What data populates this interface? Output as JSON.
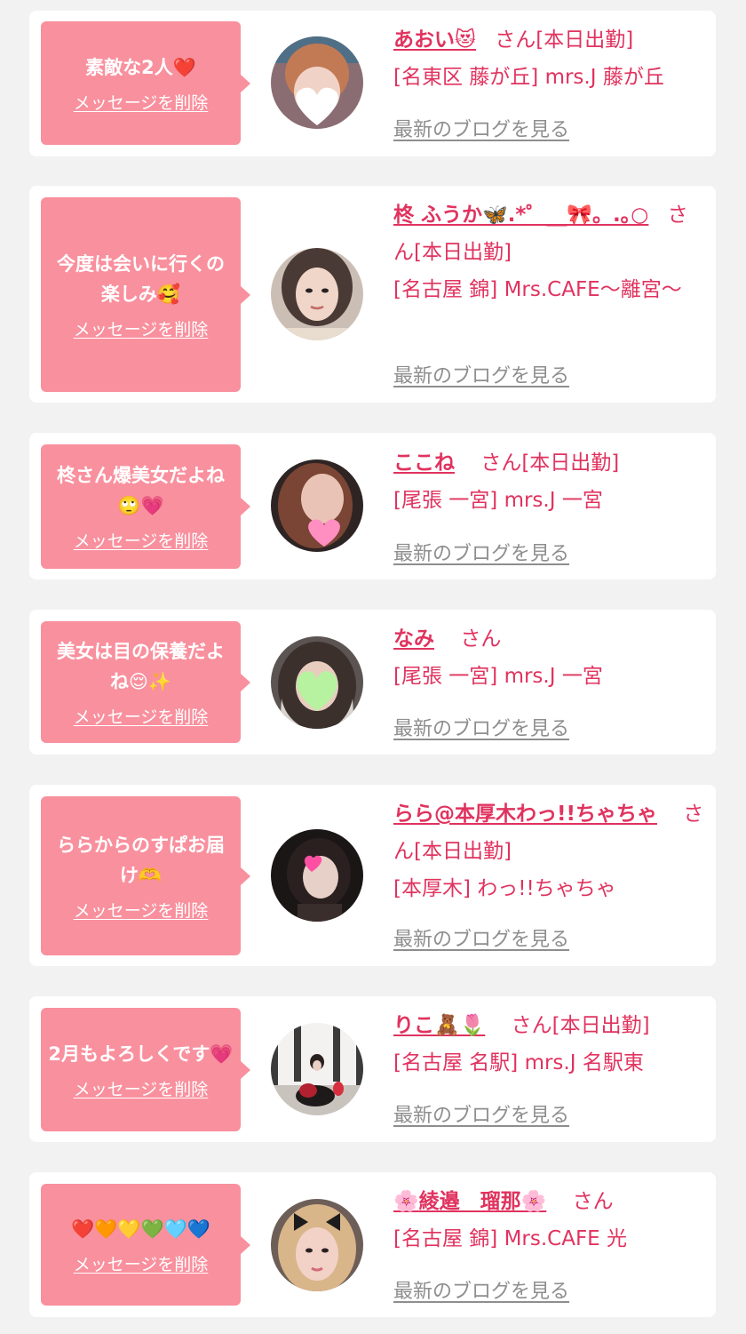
{
  "messages": [
    {
      "message": "素敵な2人❤️",
      "delete_label": "メッセージを削除",
      "avatar": "heart-blurred-avatar",
      "name": "あおい😻",
      "honorific": "さん",
      "status": "[本日出勤]",
      "shop": "[名東区 藤が丘] mrs.J 藤が丘",
      "blog_label": "最新のブログを見る"
    },
    {
      "message": "今度は会いに行くの楽しみ🥰",
      "delete_label": "メッセージを削除",
      "avatar": "woman-portrait-avatar",
      "name": "柊 ふうか🦋.*゜__🎀。.｡○",
      "honorific": "さん",
      "status": "[本日出勤]",
      "shop": "[名古屋 錦] Mrs.CAFE〜離宮〜",
      "blog_label": "最新のブログを見る"
    },
    {
      "message": "柊さん爆美女だよね🙄💗",
      "delete_label": "メッセージを削除",
      "avatar": "pink-heart-avatar",
      "name": "ここね",
      "honorific": "さん",
      "status": "[本日出勤]",
      "shop": "[尾張 一宮] mrs.J 一宮",
      "blog_label": "最新のブログを見る"
    },
    {
      "message": "美女は目の保養だよね😌✨",
      "delete_label": "メッセージを削除",
      "avatar": "green-heart-avatar",
      "name": "なみ",
      "honorific": "さん",
      "status": "",
      "shop": "[尾張 一宮] mrs.J 一宮",
      "blog_label": "最新のブログを見る"
    },
    {
      "message": "ららからのすぱお届け🫶",
      "delete_label": "メッセージを削除",
      "avatar": "dark-pink-heart-avatar",
      "name": "らら@本厚木わっ!!ちゃちゃ",
      "honorific": "さん",
      "status": "[本日出勤]",
      "shop": "[本厚木] わっ!!ちゃちゃ",
      "blog_label": "最新のブログを見る"
    },
    {
      "message": "2月もよろしくです💗",
      "delete_label": "メッセージを削除",
      "avatar": "room-bouquet-avatar",
      "name": "りこ🧸🌷",
      "honorific": "さん",
      "status": "[本日出勤]",
      "shop": "[名古屋 名駅] mrs.J 名駅東",
      "blog_label": "最新のブログを見る"
    },
    {
      "message": "❤️🧡💛💚🩵💙",
      "delete_label": "メッセージを削除",
      "avatar": "blonde-bow-avatar",
      "name": "🌸綾邉　瑠那🌸",
      "honorific": "さん",
      "status": "",
      "shop": "[名古屋 錦] Mrs.CAFE 光",
      "blog_label": "最新のブログを見る"
    }
  ],
  "colors": {
    "background": "#f2f2f2",
    "card": "#ffffff",
    "bubble": "#f9909e",
    "accent_text": "#e0335f",
    "link_gray": "#8e8e8e"
  }
}
